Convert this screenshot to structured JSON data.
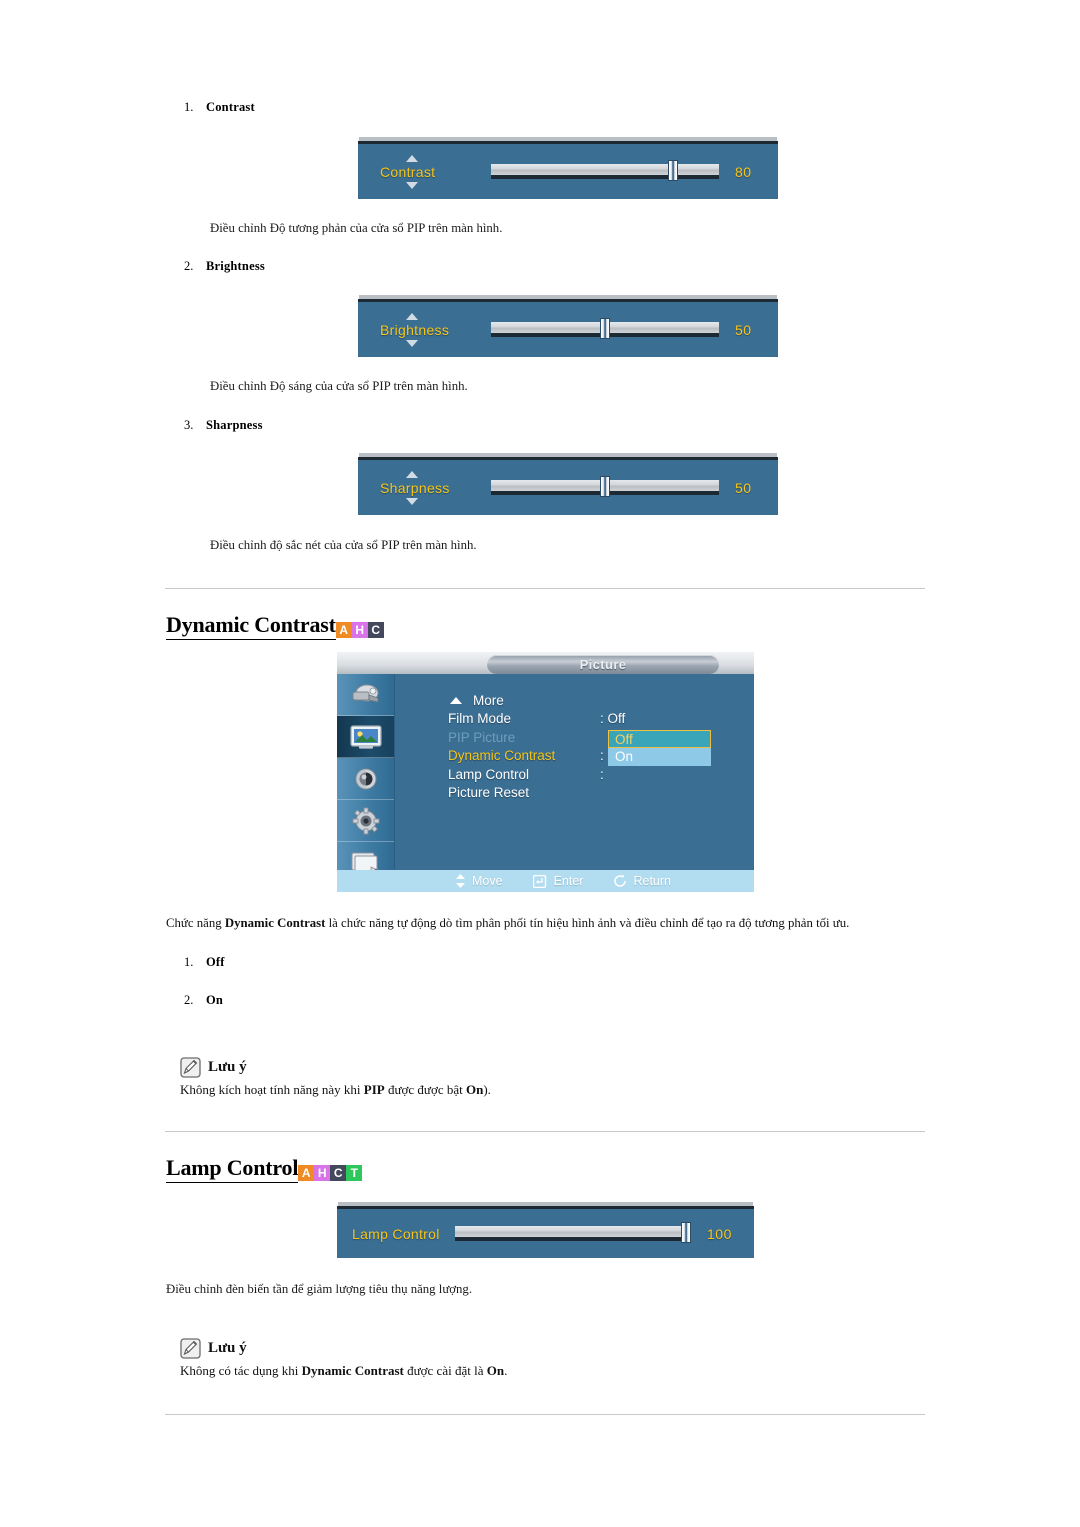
{
  "pip_items": [
    {
      "num": "1.",
      "label": "Contrast",
      "slider": {
        "label": "Contrast",
        "value": "80",
        "percent": 80,
        "arrows": true
      },
      "caption": "Điều chỉnh Độ tương phản của cửa sổ PIP trên màn hình."
    },
    {
      "num": "2.",
      "label": "Brightness",
      "slider": {
        "label": "Brightness",
        "value": "50",
        "percent": 50,
        "arrows": true
      },
      "caption": "Điều chỉnh Độ sáng của cửa sổ PIP trên màn hình."
    },
    {
      "num": "3.",
      "label": "Sharpness",
      "slider": {
        "label": "Sharpness",
        "value": "50",
        "percent": 50,
        "arrows": true
      },
      "caption": "Điều chỉnh độ sắc nét của cửa sổ PIP trên màn hình."
    }
  ],
  "dynamic_contrast": {
    "heading": "Dynamic Contrast",
    "badges": [
      {
        "letter": "A",
        "color": "#F08A24"
      },
      {
        "letter": "H",
        "color": "#D974E8"
      },
      {
        "letter": "C",
        "color": "#43485C"
      }
    ],
    "osd": {
      "title": "Picture",
      "sidebar_icons": [
        "input-source-icon",
        "picture-icon",
        "sound-icon",
        "setup-gear-icon",
        "multi-control-icon"
      ],
      "rows": [
        {
          "name": "More",
          "value": "",
          "state": "normal",
          "arrow": true
        },
        {
          "name": "Film Mode",
          "value": ": Off",
          "state": "normal",
          "arrow": false
        },
        {
          "name": "PIP Picture",
          "value": "",
          "state": "dim",
          "arrow": false
        },
        {
          "name": "Dynamic Contrast",
          "value": ":",
          "state": "highlight",
          "arrow": false
        },
        {
          "name": "Lamp Control",
          "value": ":",
          "state": "normal",
          "arrow": false
        },
        {
          "name": "Picture Reset",
          "value": "",
          "state": "normal",
          "arrow": false
        }
      ],
      "dropdown": {
        "selected": "Off",
        "options": [
          "Off",
          "On"
        ]
      },
      "footer": [
        {
          "icon": "updown-arrows-icon",
          "label": "Move"
        },
        {
          "icon": "enter-icon",
          "label": "Enter"
        },
        {
          "icon": "return-icon",
          "label": "Return"
        }
      ]
    },
    "description_pre": "Chức năng ",
    "description_bold": "Dynamic Contrast",
    "description_post": " là chức năng tự động dò tìm phân phối tín hiệu hình ảnh và điều chỉnh để tạo ra độ tương phản tối ưu.",
    "options": [
      {
        "num": "1.",
        "label": "Off"
      },
      {
        "num": "2.",
        "label": "On"
      }
    ],
    "note": {
      "title": "Lưu ý",
      "text_pre": "Không kích hoạt tính năng này khi ",
      "text_bold1": "PIP",
      "text_mid": " được được bật ",
      "text_bold2": "On",
      "text_post": ")."
    }
  },
  "lamp_control": {
    "heading": "Lamp Control",
    "badges": [
      {
        "letter": "A",
        "color": "#F08A24"
      },
      {
        "letter": "H",
        "color": "#D974E8"
      },
      {
        "letter": "C",
        "color": "#43485C"
      },
      {
        "letter": "T",
        "color": "#2EC75C"
      }
    ],
    "slider": {
      "label": "Lamp Control",
      "value": "100",
      "percent": 100,
      "arrows": false
    },
    "description": "Điều chỉnh đèn biến tần để giảm lượng tiêu thụ năng lượng.",
    "note": {
      "title": "Lưu ý",
      "text_pre": "Không có tác dụng khi ",
      "text_bold1": "Dynamic Contrast",
      "text_mid": " được cài đặt là ",
      "text_bold2": "On",
      "text_post": "."
    }
  }
}
